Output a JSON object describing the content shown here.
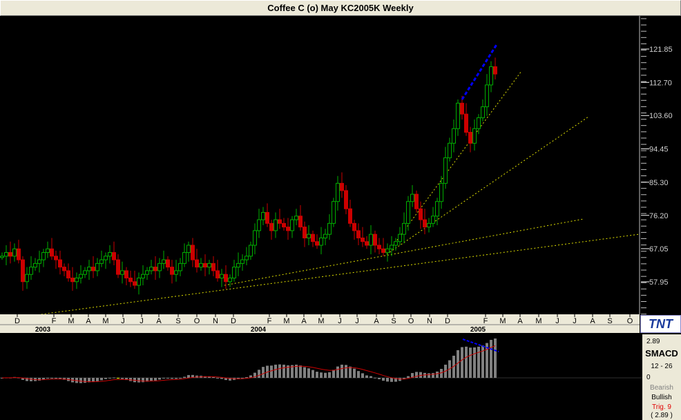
{
  "title": "Coffee C (o) May KC2005K Weekly",
  "logo": "TNT",
  "macd_panel": {
    "top_value": "2.89",
    "name": "SMACD",
    "params": "12 - 26",
    "zero": "0",
    "bearish": "Bearish",
    "bullish": "Bullish",
    "trigger": "Trig. 9",
    "current": "( 2.89 )"
  },
  "colors": {
    "up": "#00b000",
    "down": "#cc0000",
    "trend": "#e0e000",
    "divergence": "#0000ff",
    "signal": "#cc0000",
    "hist": "#808080"
  },
  "chart_data": {
    "type": "candlestick",
    "title": "Coffee C (o) May KC2005K Weekly",
    "ylim": [
      51,
      128
    ],
    "y_ticks": [
      "121.85",
      "112.70",
      "103.60",
      "94.45",
      "85.30",
      "76.20",
      "67.05",
      "57.95"
    ],
    "month_labels": [
      "D",
      "F",
      "M",
      "A",
      "M",
      "J",
      "J",
      "A",
      "S",
      "O",
      "N",
      "D",
      "F",
      "M",
      "A",
      "M",
      "J",
      "J",
      "A",
      "S",
      "O",
      "N",
      "D",
      "F",
      "M",
      "A",
      "M",
      "J",
      "J",
      "A",
      "S",
      "O"
    ],
    "year_labels": [
      "2003",
      "2004",
      "2005"
    ],
    "closes": [
      65,
      66,
      65,
      67,
      64,
      58,
      60,
      62,
      63,
      64,
      66,
      67,
      65,
      64,
      62,
      61,
      59,
      58,
      59,
      60,
      61,
      62,
      61,
      63,
      64,
      65,
      66,
      64,
      60,
      61,
      59,
      58,
      57,
      59,
      60,
      61,
      62,
      61,
      63,
      64,
      62,
      60,
      61,
      63,
      66,
      68,
      64,
      62,
      63,
      62,
      63,
      61,
      59,
      60,
      58,
      59,
      62,
      63,
      64,
      65,
      68,
      72,
      75,
      77,
      74,
      72,
      75,
      74,
      73,
      72,
      75,
      76,
      73,
      70,
      71,
      69,
      68,
      70,
      71,
      74,
      80,
      85,
      83,
      78,
      74,
      72,
      70,
      69,
      68,
      71,
      68,
      67,
      66,
      67,
      68,
      69,
      71,
      74,
      80,
      82,
      78,
      75,
      73,
      74,
      76,
      80,
      85,
      92,
      96,
      100,
      107,
      104,
      99,
      96,
      100,
      103,
      106,
      112,
      117,
      115
    ],
    "macd": {
      "fast": 12,
      "slow": 26,
      "signal": 9,
      "ylim": [
        -3.4,
        3.1
      ]
    }
  }
}
